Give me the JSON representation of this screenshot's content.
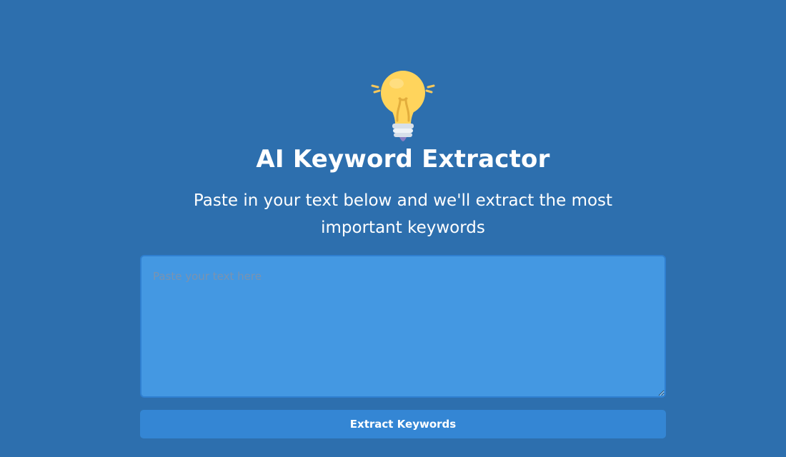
{
  "app": {
    "title": "AI Keyword Extractor",
    "subtitle": "Paste in your text below and we'll extract the most important keywords",
    "icon": "lightbulb-icon"
  },
  "form": {
    "textarea_value": "",
    "textarea_placeholder": "Paste your text here",
    "submit_label": "Extract Keywords"
  },
  "colors": {
    "background": "#2d6fae",
    "textarea_background": "#4498e2",
    "textarea_border": "#2f7fd0",
    "button_background": "#3486d4",
    "text": "#ffffff",
    "bulb_glass": "#ffd45c",
    "bulb_base": "#d7e0ea"
  }
}
